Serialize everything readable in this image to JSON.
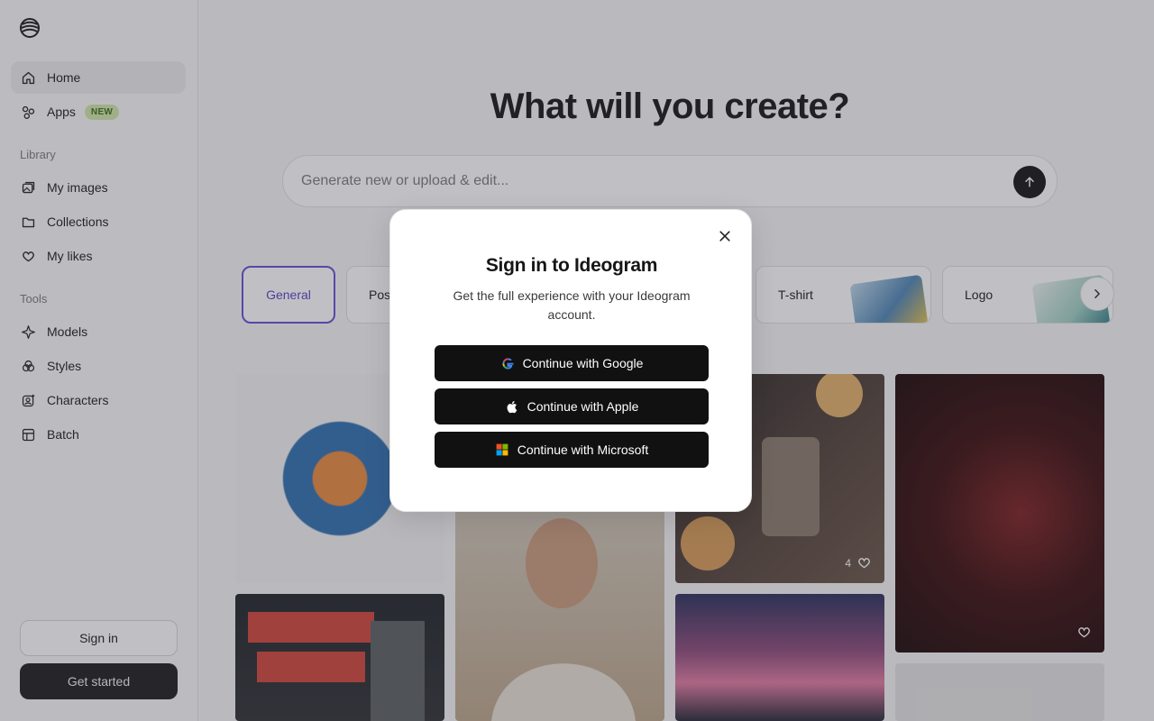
{
  "sidebar": {
    "nav": [
      {
        "label": "Home",
        "icon": "home-icon"
      },
      {
        "label": "Apps",
        "icon": "apps-icon",
        "badge": "NEW"
      }
    ],
    "library_label": "Library",
    "library": [
      {
        "label": "My images",
        "icon": "images-icon"
      },
      {
        "label": "Collections",
        "icon": "folder-icon"
      },
      {
        "label": "My likes",
        "icon": "heart-icon"
      }
    ],
    "tools_label": "Tools",
    "tools": [
      {
        "label": "Models",
        "icon": "sparkle-icon"
      },
      {
        "label": "Styles",
        "icon": "styles-icon"
      },
      {
        "label": "Characters",
        "icon": "character-icon"
      },
      {
        "label": "Batch",
        "icon": "batch-icon"
      }
    ],
    "sign_in": "Sign in",
    "get_started": "Get started"
  },
  "main": {
    "headline": "What will you create?",
    "prompt_placeholder": "Generate new or upload & edit...",
    "chips": [
      {
        "label": "General",
        "selected": true
      },
      {
        "label": "Pos"
      },
      {
        "label": "T-shirt"
      },
      {
        "label": "Logo"
      }
    ],
    "gallery": {
      "like_count_candle": "4"
    }
  },
  "modal": {
    "title": "Sign in to Ideogram",
    "subtitle": "Get the full experience with your Ideogram account.",
    "buttons": [
      {
        "label": "Continue with Google",
        "icon": "google-icon"
      },
      {
        "label": "Continue with Apple",
        "icon": "apple-icon"
      },
      {
        "label": "Continue with Microsoft",
        "icon": "microsoft-icon"
      }
    ]
  },
  "colors": {
    "accent": "#6a4ad8",
    "badge_bg": "#cfe8a8",
    "badge_text": "#3b6b17",
    "dark_button": "#111111"
  }
}
